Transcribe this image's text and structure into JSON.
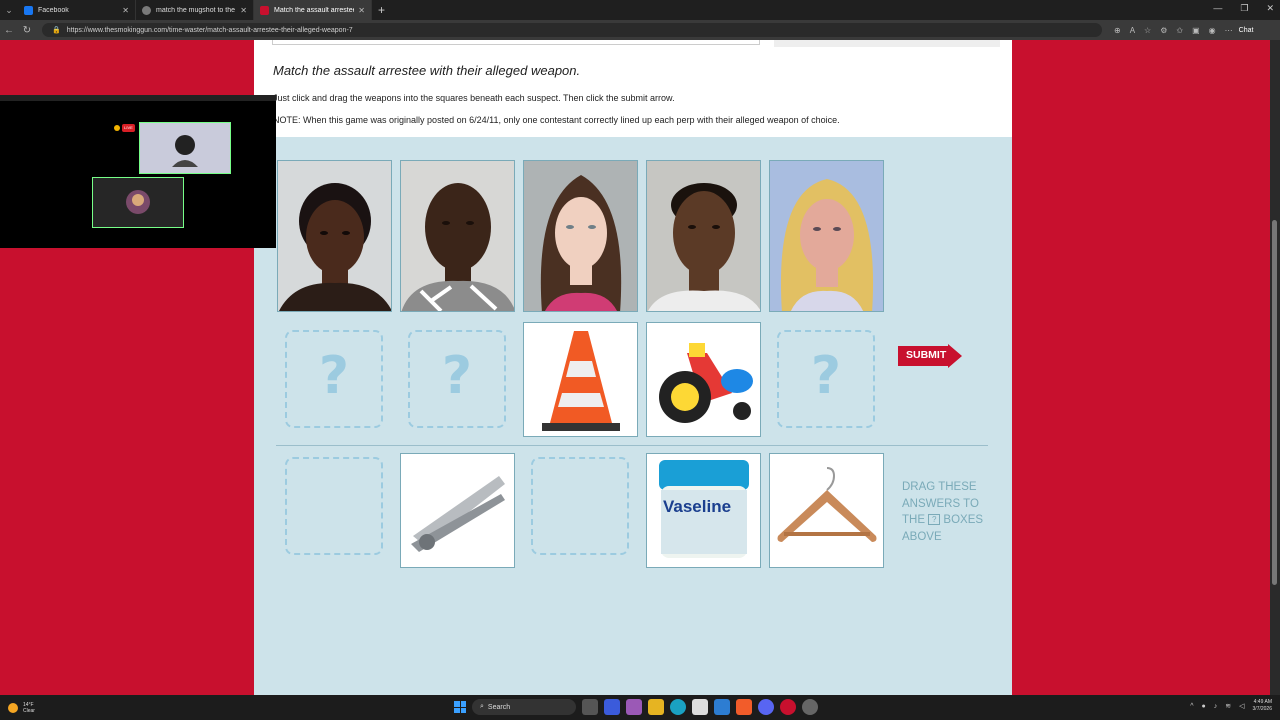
{
  "browser": {
    "tabs": [
      {
        "title": "Facebook",
        "favicon_color": "#1877f2",
        "active": false
      },
      {
        "title": "match the mugshot to the crime -",
        "favicon_color": "#7a7a7a",
        "active": false
      },
      {
        "title": "Match the assault arrestee with th...",
        "favicon_color": "#c8102e",
        "active": true
      }
    ],
    "url": "https://www.thesmokinggun.com/time-waster/match-assault-arrestee-their-alleged-weapon-7",
    "copilot_label": "Chat"
  },
  "game": {
    "heading": "Match the assault arrestee with their alleged weapon.",
    "instructions": "Just click and drag the weapons into the squares beneath each suspect. Then click the submit arrow.",
    "note": "NOTE: When this game was originally posted on 6/24/11, only one contestant correctly lined up each perp with their alleged weapon of choice.",
    "placeholder_symbol": "?",
    "submit_label": "SUBMIT",
    "drag_note_lines": [
      "DRAG THESE",
      "ANSWERS TO",
      "BOXES",
      "ABOVE"
    ],
    "drag_note_the": "THE",
    "qbox_symbol": "?",
    "placed_items": [
      "traffic-cone",
      "big-wheel-tricycle"
    ],
    "answer_items": [
      "nail-clippers",
      "vaseline-jar",
      "wooden-hanger"
    ],
    "vaseline_label": "Vaseline",
    "accent_color": "#c8102e",
    "panel_color": "#cde3ea"
  },
  "video_overlay": {
    "live_label": "LIVE"
  },
  "taskbar": {
    "weather_temp": "14°F",
    "weather_cond": "Clear",
    "search_label": "Search",
    "time": "4:49 AM",
    "date": "3/7/2026"
  }
}
